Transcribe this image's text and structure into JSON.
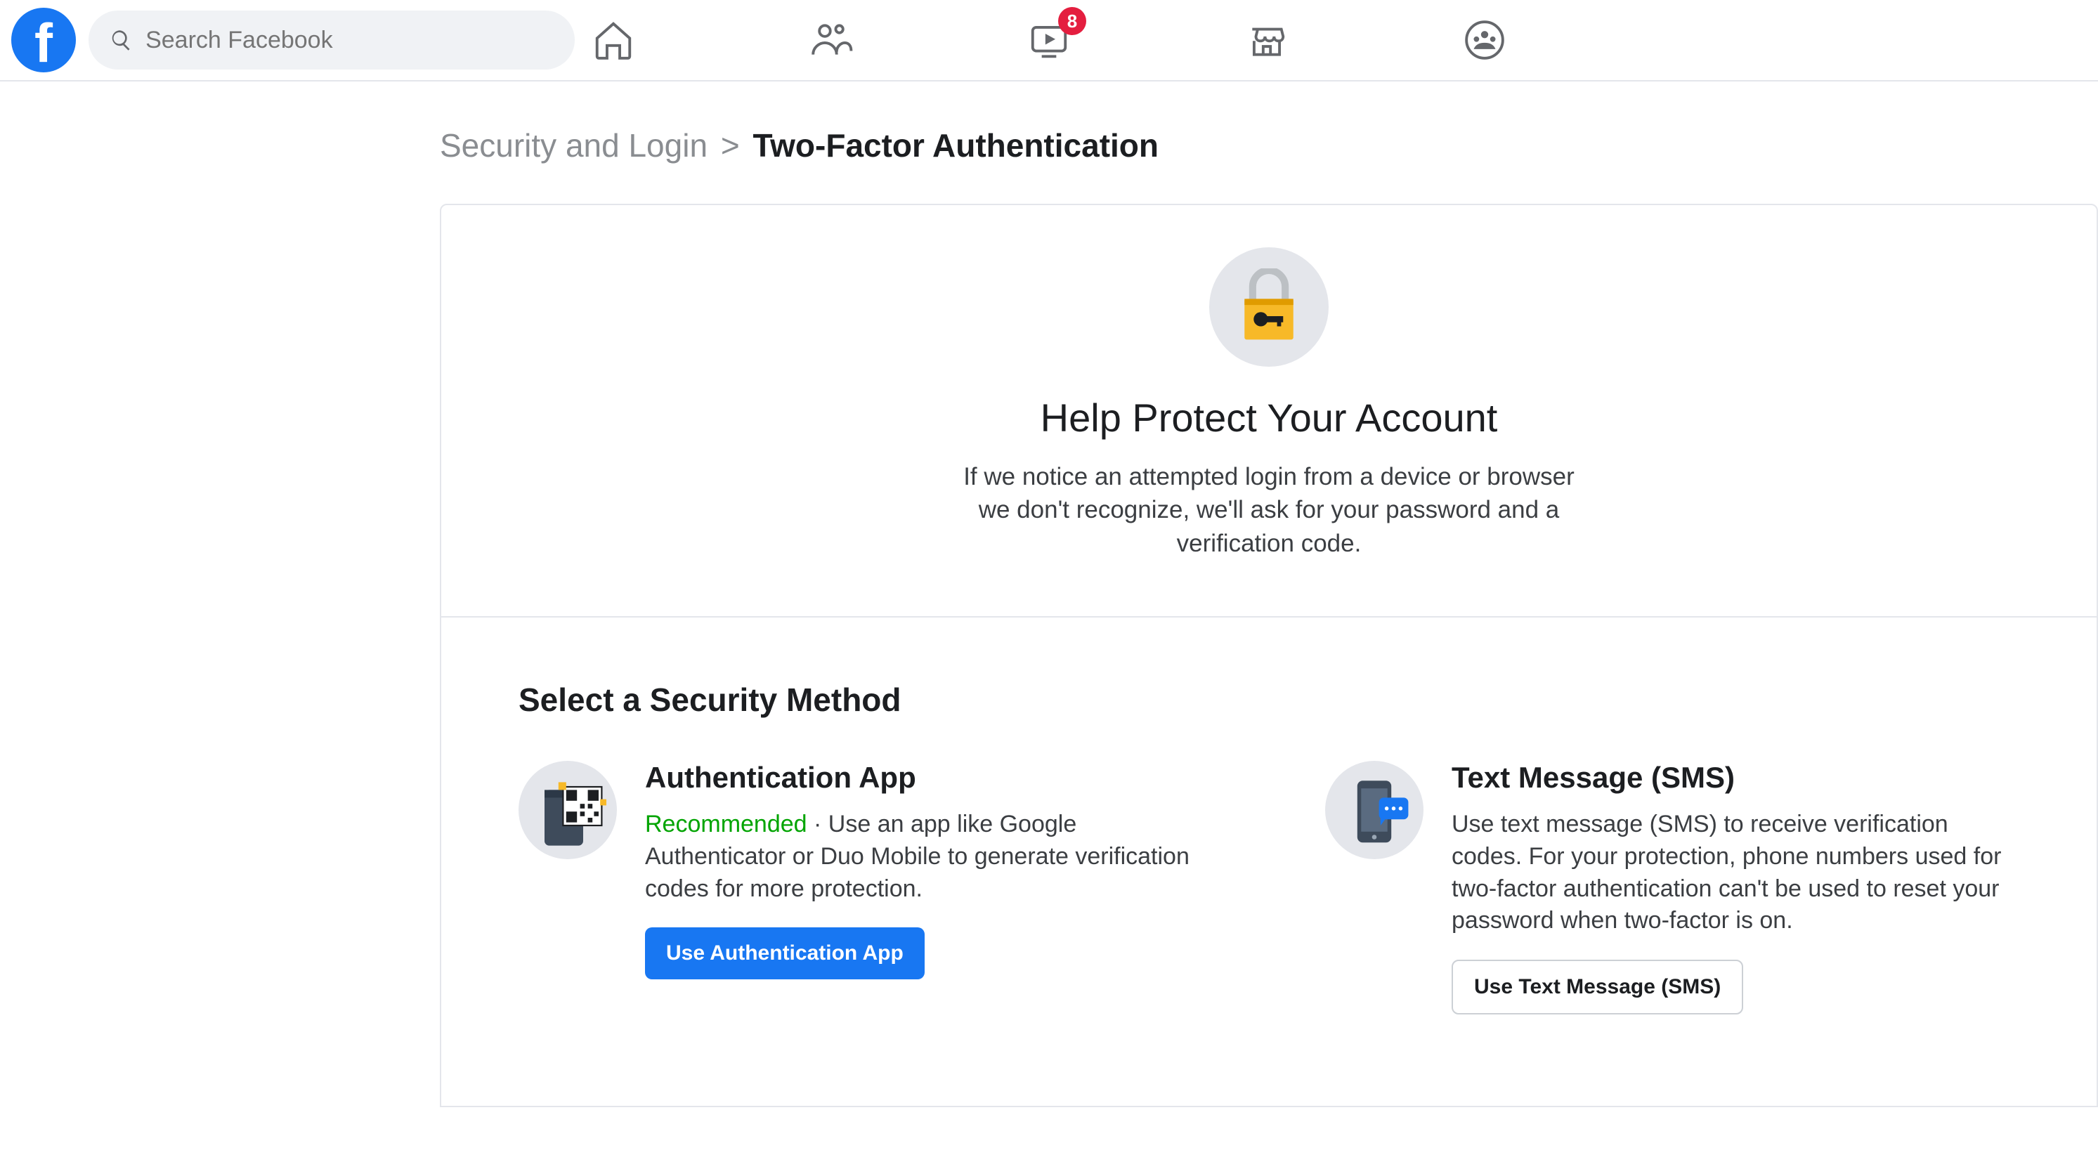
{
  "header": {
    "search_placeholder": "Search Facebook",
    "watch_badge": "8"
  },
  "breadcrumb": {
    "parent": "Security and Login",
    "separator": ">",
    "current": "Two-Factor Authentication"
  },
  "hero": {
    "title": "Help Protect Your Account",
    "description": "If we notice an attempted login from a device or browser we don't recognize, we'll ask for your password and a verification code."
  },
  "methods": {
    "heading": "Select a Security Method",
    "auth_app": {
      "title": "Authentication App",
      "recommended": "Recommended",
      "middot": "·",
      "description": "Use an app like Google Authenticator or Duo Mobile to generate verification codes for more protection.",
      "button": "Use Authentication App"
    },
    "sms": {
      "title": "Text Message (SMS)",
      "description": "Use text message (SMS) to receive verification codes. For your protection, phone numbers used for two-factor authentication can't be used to reset your password when two-factor is on.",
      "button": "Use Text Message (SMS)"
    }
  }
}
